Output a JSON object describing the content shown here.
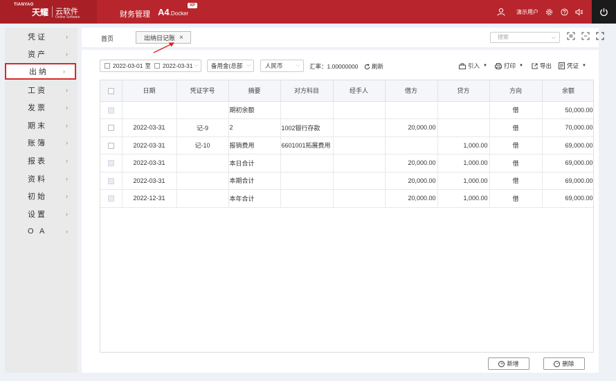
{
  "header": {
    "logo_top": "TIANYAO",
    "logo_main": "天耀",
    "logo_cloud": "云软件",
    "logo_sub": "Online Software",
    "app_name": "财务管理",
    "version_main": "A4",
    "version_sub": ".Docker",
    "version_badge": "XP",
    "user_name": "演示用户"
  },
  "sidebar": {
    "items": [
      {
        "label": "凭证"
      },
      {
        "label": "资产"
      },
      {
        "label": "出纳"
      },
      {
        "label": "工资"
      },
      {
        "label": "发票"
      },
      {
        "label": "期末"
      },
      {
        "label": "账簿"
      },
      {
        "label": "报表"
      },
      {
        "label": "资料"
      },
      {
        "label": "初始"
      },
      {
        "label": "设置"
      },
      {
        "label": "O A"
      }
    ],
    "active_index": 2
  },
  "tabs": {
    "home": "首页",
    "active": "出纳日记账",
    "close": "×"
  },
  "search": {
    "placeholder": "搜索"
  },
  "toolbar": {
    "date_from": "2022-03-01",
    "date_to_word": "至",
    "date_to": "2022-03-31",
    "account": "备用金(总部",
    "currency": "人民币",
    "rate_label": "汇率：",
    "rate_value": "1.00000000",
    "refresh": "刷新",
    "import": "引入",
    "print": "打印",
    "export": "导出",
    "voucher": "凭证"
  },
  "table": {
    "columns": [
      "日期",
      "凭证字号",
      "摘要",
      "对方科目",
      "经手人",
      "借方",
      "贷方",
      "方向",
      "余额"
    ],
    "rows": [
      {
        "date": "",
        "voucher": "",
        "summary": "期初余额",
        "account": "",
        "handler": "",
        "debit": "",
        "credit": "",
        "direction": "借",
        "balance": "50,000.00",
        "checkbox_disabled": true
      },
      {
        "date": "2022-03-31",
        "voucher": "记-9",
        "summary": "2",
        "account": "1002银行存款",
        "handler": "",
        "debit": "20,000.00",
        "credit": "",
        "direction": "借",
        "balance": "70,000.00",
        "checkbox_disabled": false
      },
      {
        "date": "2022-03-31",
        "voucher": "记-10",
        "summary": "报销费用",
        "account": "6601001拓展费用",
        "handler": "",
        "debit": "",
        "credit": "1,000.00",
        "direction": "借",
        "balance": "69,000.00",
        "checkbox_disabled": false
      },
      {
        "date": "2022-03-31",
        "voucher": "",
        "summary": "本日合计",
        "account": "",
        "handler": "",
        "debit": "20,000.00",
        "credit": "1,000.00",
        "direction": "借",
        "balance": "69,000.00",
        "checkbox_disabled": true
      },
      {
        "date": "2022-03-31",
        "voucher": "",
        "summary": "本期合计",
        "account": "",
        "handler": "",
        "debit": "20,000.00",
        "credit": "1,000.00",
        "direction": "借",
        "balance": "69,000.00",
        "checkbox_disabled": true
      },
      {
        "date": "2022-12-31",
        "voucher": "",
        "summary": "本年合计",
        "account": "",
        "handler": "",
        "debit": "20,000.00",
        "credit": "1,000.00",
        "direction": "借",
        "balance": "69,000.00",
        "checkbox_disabled": true
      }
    ]
  },
  "footer": {
    "add": "新增",
    "delete": "删除"
  },
  "colors": {
    "header_red": "#b8252c",
    "highlight_red": "#d42a2a"
  }
}
